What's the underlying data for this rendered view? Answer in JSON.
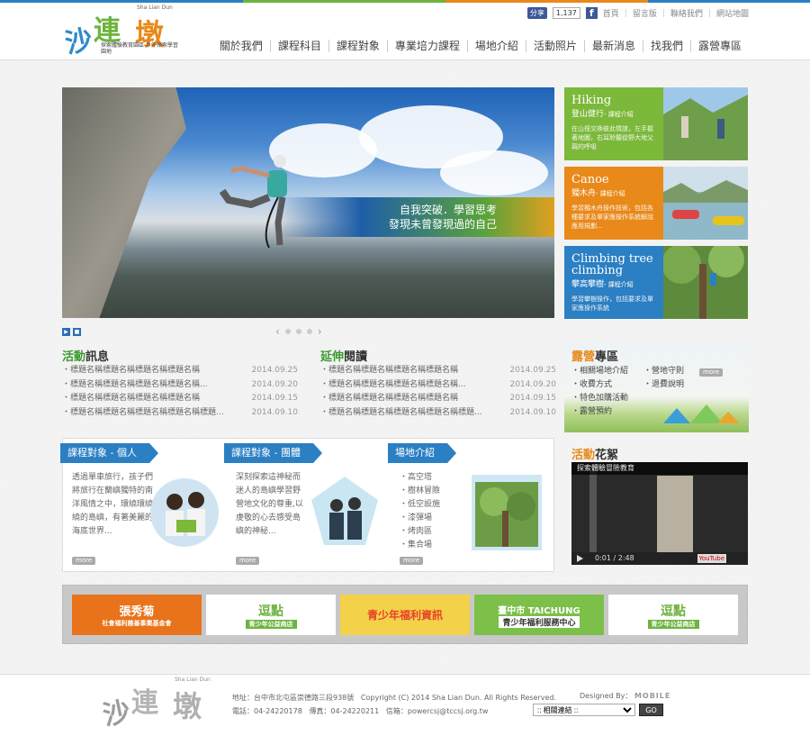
{
  "brand": {
    "en": "Sha Lian Dun",
    "c1": "沙",
    "c2": "連",
    "c3": "墩",
    "tagline": "探索體驗教育園區 戶外探索學習園地"
  },
  "toplinks": {
    "share": "分享",
    "count": "1,137",
    "fb": "f",
    "items": [
      "首頁",
      "留言版",
      "聯絡我們",
      "網站地圖"
    ]
  },
  "nav": [
    "關於我們",
    "課程科目",
    "課程對象",
    "專業培力課程",
    "場地介紹",
    "活動照片",
    "最新消息",
    "找我們",
    "露營專區"
  ],
  "hero": {
    "line1": "自我突破．學習思考",
    "line2": "發現未曾發現過的自己"
  },
  "tiles": [
    {
      "en": "Hiking",
      "zh": "登山健行",
      "more": "- 課程介紹",
      "desc": "在山徑交換彼此情誼，左手握著地圖，右耳聆聽從野大地父親的呼吸",
      "color": "#7cb83a"
    },
    {
      "en": "Canoe",
      "zh": "獨木舟",
      "more": "- 課程介紹",
      "desc": "學習獨木舟操作技術，包括各種要求及單家應操作系統解說應用規劃...",
      "color": "#e8891a"
    },
    {
      "en": "Climbing tree climbing",
      "zh": "攀高攀樹",
      "more": "- 課程介紹",
      "desc": "學習攀樹操作，包括要求及單家應操作系統",
      "color": "#2b7fc3"
    }
  ],
  "news": {
    "title_a": "活動",
    "title_b": "訊息",
    "items": [
      {
        "t": "標題名稱標題名稱標題名稱標題名稱",
        "d": "2014.09.25"
      },
      {
        "t": "標題名稱標題名稱標題名稱標題名稱...",
        "d": "2014.09.20"
      },
      {
        "t": "標題名稱標題名稱標題名稱標題名稱",
        "d": "2014.09.15"
      },
      {
        "t": "標題名稱標題名稱標題名稱標題名稱標題...",
        "d": "2014.09.10"
      }
    ]
  },
  "reading": {
    "title_a": "延伸",
    "title_b": "閱讀",
    "items": [
      {
        "t": "標題名稱標題名稱標題名稱標題名稱",
        "d": "2014.09.25"
      },
      {
        "t": "標題名稱標題名稱標題名稱標題名稱...",
        "d": "2014.09.20"
      },
      {
        "t": "標題名稱標題名稱標題名稱標題名稱",
        "d": "2014.09.15"
      },
      {
        "t": "標題名稱標題名稱標題名稱標題名稱標題...",
        "d": "2014.09.10"
      }
    ]
  },
  "camp": {
    "title_a": "露營",
    "title_b": "專區",
    "col1": [
      "相關場地介紹",
      "收費方式",
      "特色加購活動",
      "露營預約"
    ],
    "col2": [
      "營地守則",
      "退費說明"
    ],
    "more": "more"
  },
  "cards": [
    {
      "tab": "課程對象 - 個人",
      "body": "透過單車旅行，孩子們將旅行在蘭嶼獨特的南洋風情之中，環繞環繞繞的島嶼，有著美麗的海底世界...",
      "more": "more"
    },
    {
      "tab": "課程對象 - 團體",
      "body": "深刻探索這神秘而迷人的島嶼學習野營地文化的尊重,以虔敬的心去感受島嶼的神秘...",
      "more": "more"
    },
    {
      "tab": "場地介紹",
      "items": [
        "高空塔",
        "樹林冒險",
        "低空設施",
        "漆彈場",
        "烤肉區",
        "集合場"
      ],
      "more": "more"
    }
  ],
  "video": {
    "title_a": "活動",
    "title_b": "花絮",
    "caption": "探索體驗冒險教育",
    "time": "0:01",
    "dur": "/ 2:48",
    "yt": "YouTube"
  },
  "banners": [
    {
      "main": "張秀菊",
      "sub": "社會福利慈善事業基金會"
    },
    {
      "main": "逗點",
      "sub": "青少年公益商店"
    },
    {
      "main": "青少年福利資訊",
      "sub": ""
    },
    {
      "main": "臺中市 TAICHUNG",
      "sub": "青少年福利服務中心"
    },
    {
      "main": "逗點",
      "sub": "青少年公益商店"
    }
  ],
  "footer": {
    "addr": "地址：台中市北屯區崇德路三段938號",
    "copy": "Copyright (C) 2014 Sha Lian Dun.  All Rights Reserved.",
    "tel": "電話：04-24220178",
    "fax": "傳真：04-24220211",
    "mail": "信箱：powercsj@tccsj.org.tw",
    "designed": "Designed By：",
    "mobile": "MOBILE",
    "select": "::        相關連結        ::",
    "go": "GO"
  }
}
